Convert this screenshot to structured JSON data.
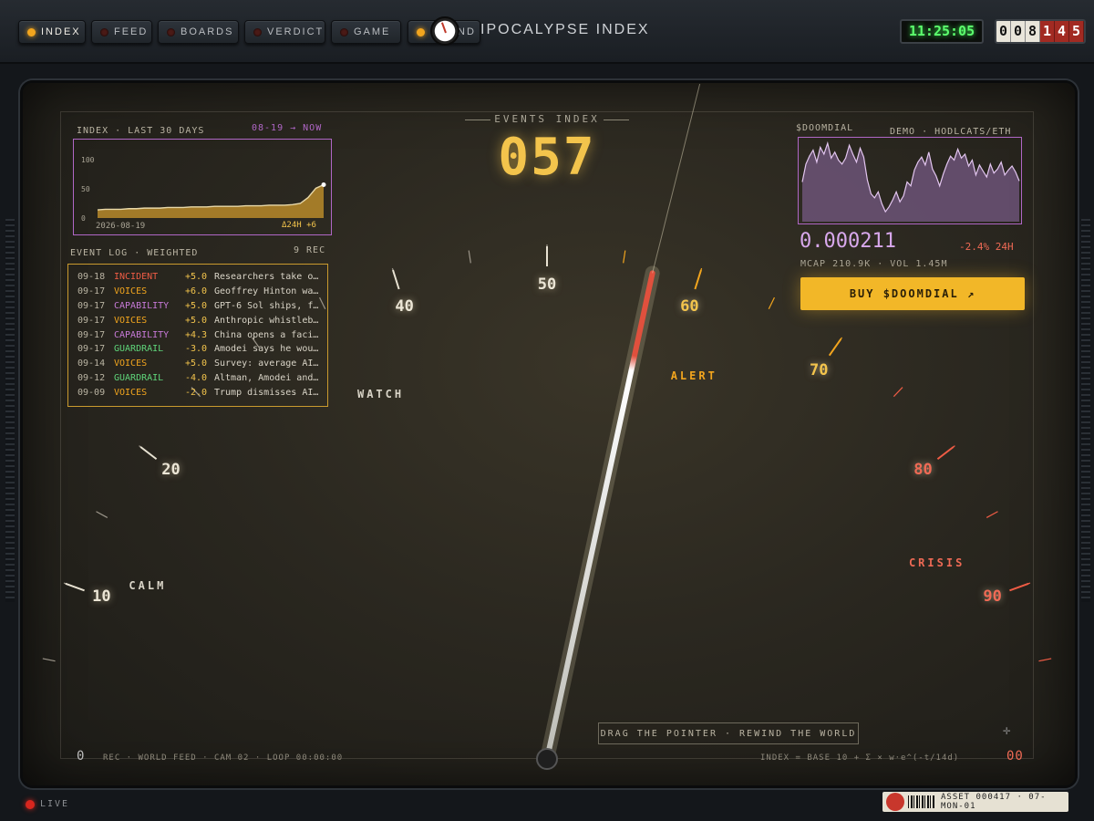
{
  "nav": {
    "items": [
      {
        "label": "INDEX",
        "state": "active"
      },
      {
        "label": "FEED",
        "state": "off"
      },
      {
        "label": "BOARDS",
        "state": "off"
      },
      {
        "label": "VERDICT",
        "state": "off"
      },
      {
        "label": "GAME",
        "state": "off"
      },
      {
        "label": "ND",
        "state": "lit"
      }
    ]
  },
  "header": {
    "title": "IPOCALYPSE INDEX",
    "clock": "11:25:05",
    "counter": {
      "white_digits": [
        "0",
        "0",
        "8"
      ],
      "red_digits": [
        "1",
        "4",
        "5"
      ]
    }
  },
  "events_index": {
    "label": "EVENTS INDEX",
    "value": "057"
  },
  "index_chart": {
    "title": "INDEX · LAST 30 DAYS",
    "range_label": "08-19 → NOW",
    "start_date": "2026-08-19",
    "delta_label": "Δ24H +6",
    "chart_data": {
      "type": "area",
      "y_ticks": [
        "100",
        "50",
        "0"
      ],
      "ylim": [
        0,
        100
      ],
      "values": [
        14,
        15,
        15,
        15,
        16,
        16,
        17,
        17,
        17,
        18,
        18,
        18,
        19,
        19,
        19,
        20,
        20,
        20,
        20,
        21,
        21,
        21,
        22,
        22,
        22,
        23,
        25,
        35,
        51,
        57
      ]
    }
  },
  "event_log": {
    "title": "EVENT LOG · WEIGHTED",
    "count_label": "9 REC",
    "rows": [
      {
        "date": "09-18",
        "category": "INCIDENT",
        "cat_color": "#ef5c45",
        "delta": "+5.0",
        "text": "Researchers take o…"
      },
      {
        "date": "09-17",
        "category": "VOICES",
        "cat_color": "#f2a51e",
        "delta": "+6.0",
        "text": "Geoffrey Hinton wa…"
      },
      {
        "date": "09-17",
        "category": "CAPABILITY",
        "cat_color": "#c77ad8",
        "delta": "+5.0",
        "text": "GPT-6 Sol ships, f…"
      },
      {
        "date": "09-17",
        "category": "VOICES",
        "cat_color": "#f2a51e",
        "delta": "+5.0",
        "text": "Anthropic whistleb…"
      },
      {
        "date": "09-17",
        "category": "CAPABILITY",
        "cat_color": "#c77ad8",
        "delta": "+4.3",
        "text": "China opens a faci…"
      },
      {
        "date": "09-17",
        "category": "GUARDRAIL",
        "cat_color": "#5fd47a",
        "delta": "-3.0",
        "text": "Amodei says he wou…"
      },
      {
        "date": "09-14",
        "category": "VOICES",
        "cat_color": "#f2a51e",
        "delta": "+5.0",
        "text": "Survey: average AI…"
      },
      {
        "date": "09-12",
        "category": "GUARDRAIL",
        "cat_color": "#5fd47a",
        "delta": "-4.0",
        "text": "Altman, Amodei and…"
      },
      {
        "date": "09-09",
        "category": "VOICES",
        "cat_color": "#f2a51e",
        "delta": "-2.0",
        "text": "Trump dismisses AI…"
      }
    ]
  },
  "gauge": {
    "value": 57,
    "ticks": [
      {
        "v": 10,
        "label": "10",
        "tone": "white"
      },
      {
        "v": 20,
        "label": "20",
        "tone": "white"
      },
      {
        "v": 40,
        "label": "40",
        "tone": "white"
      },
      {
        "v": 50,
        "label": "50",
        "tone": "white"
      },
      {
        "v": 60,
        "label": "60",
        "tone": "amber"
      },
      {
        "v": 70,
        "label": "70",
        "tone": "amber"
      },
      {
        "v": 80,
        "label": "80",
        "tone": "red"
      },
      {
        "v": 90,
        "label": "90",
        "tone": "red"
      }
    ],
    "zones": [
      {
        "label": "CALM",
        "color": "#d9d4c7"
      },
      {
        "label": "WATCH",
        "color": "#d9d4c7"
      },
      {
        "label": "ALERT",
        "color": "#f2a51e"
      },
      {
        "label": "CRISIS",
        "color": "#ef6a55"
      }
    ],
    "hint": "DRAG THE POINTER · REWIND THE WORLD"
  },
  "token": {
    "title": "$DOOMDIAL",
    "subtitle": "DEMO · HODLCATS/ETH",
    "price": "0.000211",
    "change": "-2.4% 24H",
    "stats": "MCAP 210.9K · VOL 1.45M",
    "buy_label": "BUY $DOOMDIAL ↗",
    "chart_data": {
      "type": "area",
      "values": [
        40,
        58,
        66,
        72,
        60,
        75,
        68,
        79,
        64,
        70,
        62,
        58,
        64,
        77,
        68,
        60,
        74,
        65,
        42,
        28,
        24,
        30,
        18,
        10,
        15,
        22,
        30,
        20,
        26,
        40,
        36,
        52,
        60,
        65,
        57,
        70,
        53,
        46,
        36,
        48,
        58,
        66,
        62,
        73,
        64,
        68,
        56,
        62,
        47,
        57,
        51,
        45,
        58,
        49,
        53,
        60,
        47,
        52,
        56,
        50,
        41
      ]
    }
  },
  "footer": {
    "left": "REC · WORLD FEED · CAM 02 · LOOP 00:00:00",
    "right": "INDEX = BASE 10 + Σ × w·e^(-t/14d)",
    "min_label": "0",
    "max_label": "00",
    "live": "LIVE",
    "asset": "ASSET 000417 · 07-MON-01"
  }
}
